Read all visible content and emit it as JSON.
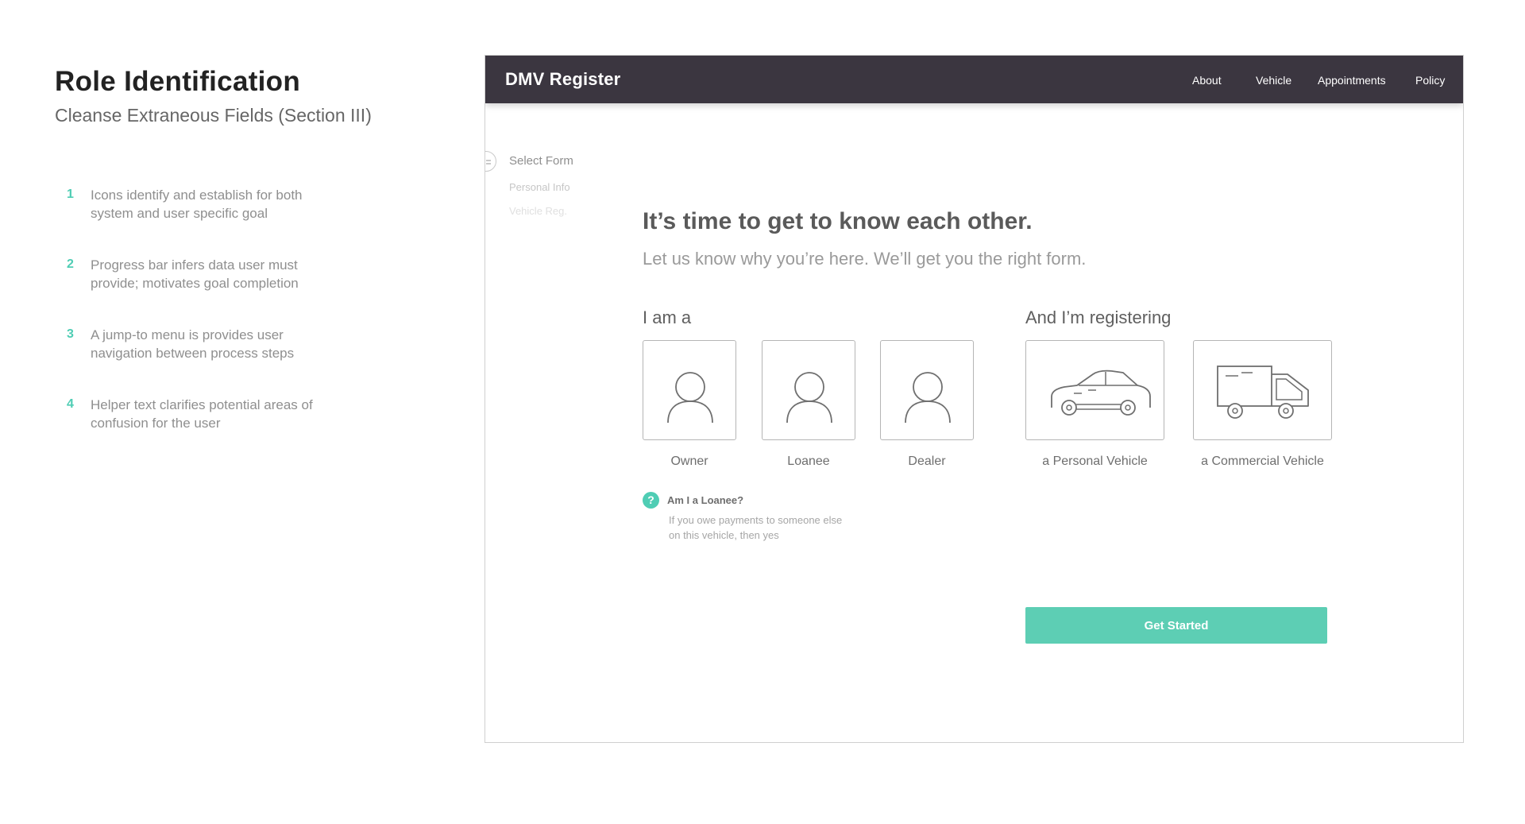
{
  "annotation": {
    "title": "Role Identification",
    "subtitle": "Cleanse Extraneous Fields (Section III)",
    "items": [
      {
        "num": "1",
        "text": "Icons identify and establish for both system and user specific goal"
      },
      {
        "num": "2",
        "text": "Progress bar infers data user must provide; motivates goal completion"
      },
      {
        "num": "3",
        "text": "A jump-to menu is provides user navigation between process steps"
      },
      {
        "num": "4",
        "text": "Helper text clarifies potential areas of confusion for the user"
      }
    ]
  },
  "app": {
    "brand": "DMV Register",
    "nav": [
      "About",
      "Vehicle",
      "Appointments",
      "Policy"
    ]
  },
  "steps": [
    "Select Form",
    "Personal Info",
    "Vehicle Reg."
  ],
  "main": {
    "headline": "It’s time to get to know each other.",
    "subhead": "Let us know why you’re here. We’ll get you the right form.",
    "role_group_label": "I am a",
    "vehicle_group_label": "And I’m registering",
    "roles": [
      {
        "label": "Owner",
        "icon": "person-icon"
      },
      {
        "label": "Loanee",
        "icon": "person-icon"
      },
      {
        "label": "Dealer",
        "icon": "person-icon"
      }
    ],
    "vehicles": [
      {
        "label": "a Personal Vehicle",
        "icon": "car-icon"
      },
      {
        "label": "a Commercial Vehicle",
        "icon": "truck-icon"
      }
    ],
    "help": {
      "icon_glyph": "?",
      "title": "Am I a Loanee?",
      "body": "If you owe payments to someone else on this vehicle, then yes"
    },
    "cta_label": "Get Started"
  },
  "colors": {
    "accent": "#5dceb4",
    "navbar": "#3b3640",
    "annotation_number": "#4fcdb4"
  }
}
